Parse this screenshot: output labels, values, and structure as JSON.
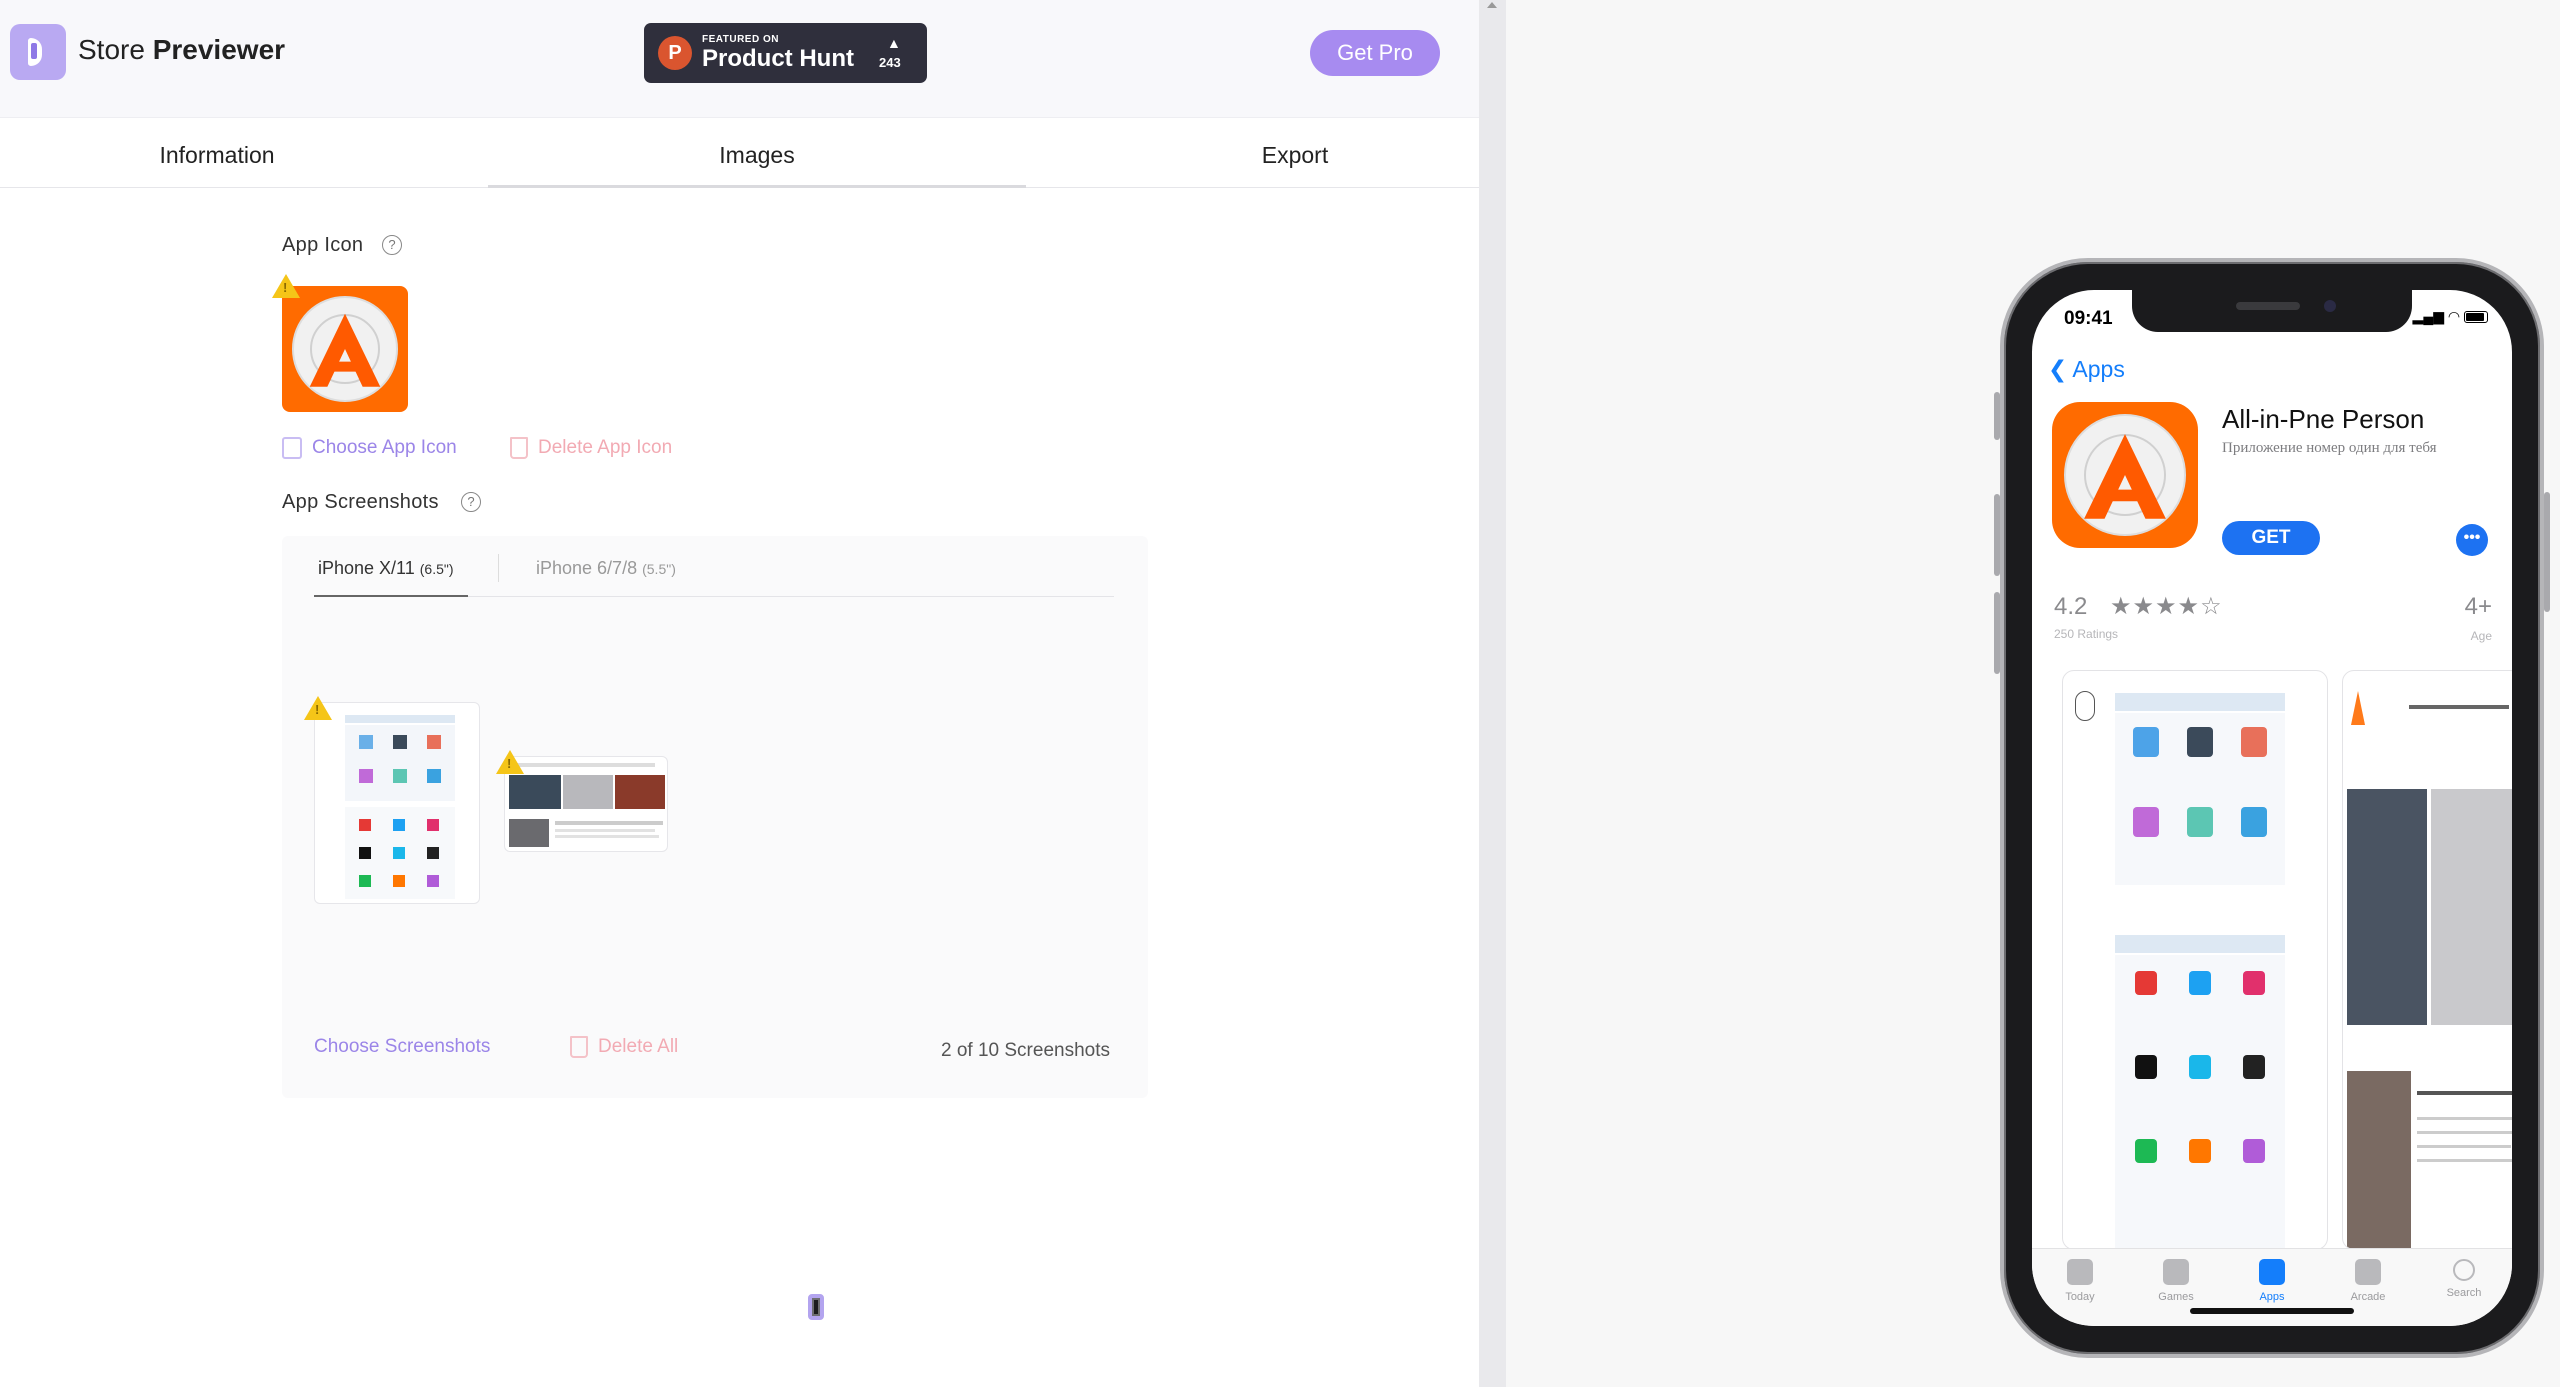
{
  "brand": {
    "name_light": "Store",
    "name_bold": "Previewer"
  },
  "product_hunt": {
    "featured": "FEATURED ON",
    "name": "Product Hunt",
    "count": "243",
    "letter": "P"
  },
  "header": {
    "get_pro": "Get Pro"
  },
  "tabs": [
    {
      "label": "Information"
    },
    {
      "label": "Images",
      "active": true
    },
    {
      "label": "Export"
    }
  ],
  "app_icon": {
    "label": "App Icon",
    "help": "?",
    "choose": "Choose App Icon",
    "delete": "Delete App Icon"
  },
  "screenshots": {
    "label": "App Screenshots",
    "help": "?",
    "subtabs": [
      {
        "label": "iPhone X/11",
        "size": "(6.5\")",
        "active": true
      },
      {
        "label": "iPhone 6/7/8",
        "size": "(5.5\")"
      }
    ],
    "choose": "Choose Screenshots",
    "delete_all": "Delete All",
    "count": "2 of 10 Screenshots"
  },
  "device": {
    "time": "09:41",
    "back": "Apps",
    "app_title": "All-in-Pne Person",
    "app_subtitle": "Приложение номер один для тебя",
    "get": "GET",
    "more": "•••",
    "rating": "4.2",
    "stars": "★★★★☆",
    "ratings_count": "250 Ratings",
    "age": "4+",
    "age_label": "Age",
    "tabbar": [
      {
        "label": "Today",
        "icon": "today-icon"
      },
      {
        "label": "Games",
        "icon": "rocket-icon"
      },
      {
        "label": "Apps",
        "icon": "apps-stack-icon",
        "active": true
      },
      {
        "label": "Arcade",
        "icon": "arcade-icon"
      },
      {
        "label": "Search",
        "icon": "search-icon"
      }
    ]
  },
  "colors": {
    "accent": "#a78bf0",
    "ios_blue": "#147efb",
    "icon_orange": "#ff6b00",
    "warning": "#f5c518",
    "delete_disabled": "#f2aab3"
  }
}
